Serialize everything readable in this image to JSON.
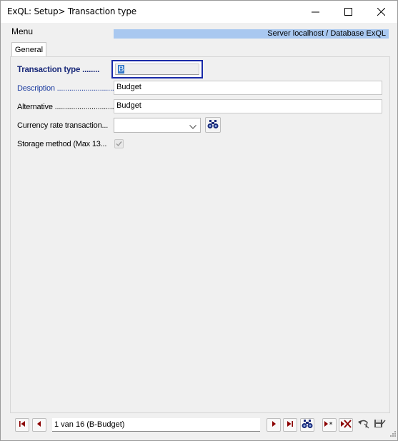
{
  "window": {
    "title": "ExQL: Setup> Transaction type",
    "controls": [
      "minimize-icon",
      "maximize-icon",
      "close-icon"
    ]
  },
  "menu": {
    "label": "Menu"
  },
  "server_banner": "Server localhost / Database ExQL",
  "tabs": [
    {
      "label": "General",
      "active": true
    }
  ],
  "form": {
    "transaction_type": {
      "label": "Transaction type ........",
      "value": "B"
    },
    "description": {
      "label": "Description ..............................",
      "value": "Budget"
    },
    "alternative": {
      "label": "Alternative .............................",
      "value": "Budget"
    },
    "currency_rate": {
      "label": "Currency rate transaction...",
      "value": ""
    },
    "storage_method": {
      "label": "Storage method (Max 13...",
      "checked": true
    }
  },
  "footer": {
    "record_position": "1 van 16 (B-Budget)"
  },
  "icons": {
    "first": "first-record-icon",
    "prev": "previous-record-icon",
    "next": "next-record-icon",
    "last": "last-record-icon",
    "find": "binoculars-icon",
    "new": "new-record-icon",
    "delete": "delete-record-icon",
    "undo": "undo-icon",
    "save": "save-icon"
  },
  "colors": {
    "accent_blue": "#1a2aa8",
    "banner": "#a9c8f0",
    "nav_red": "#8b0000"
  }
}
